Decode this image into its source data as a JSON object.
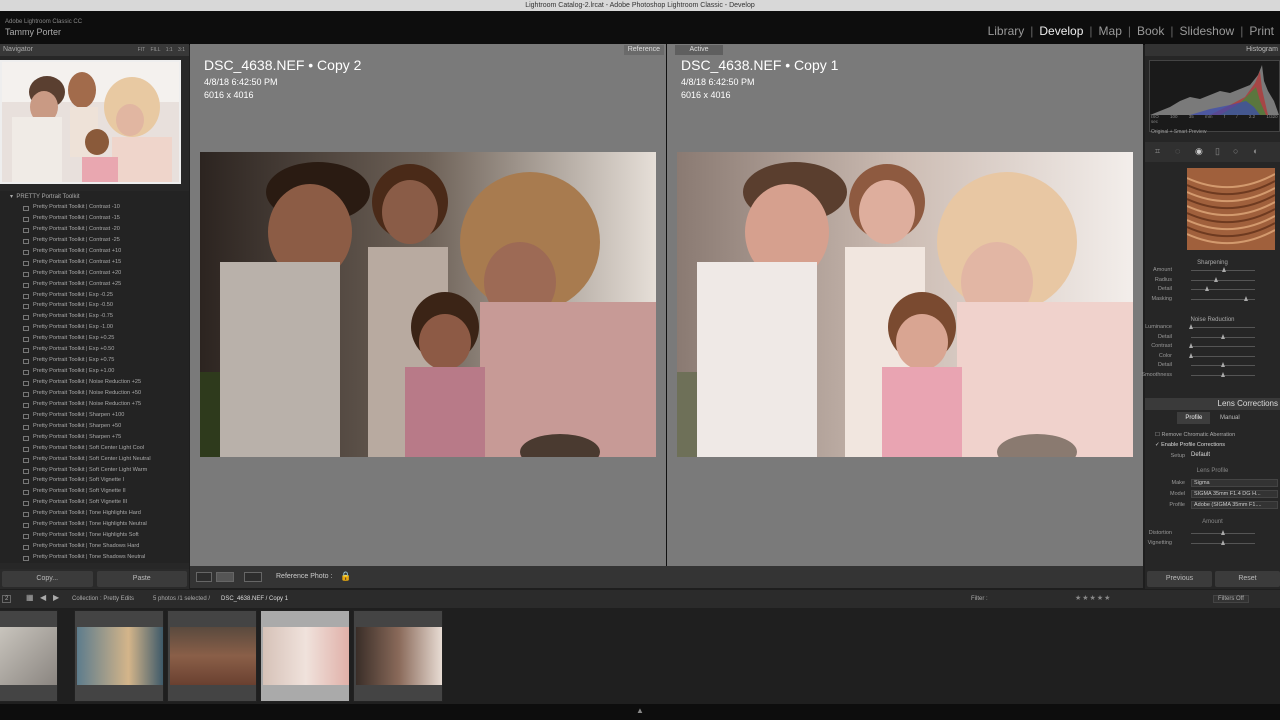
{
  "window": {
    "title": "Lightroom Catalog-2.lrcat - Adobe Photoshop Lightroom Classic - Develop"
  },
  "identity": {
    "app": "Adobe Lightroom Classic CC",
    "user": "Tammy Porter"
  },
  "modules": [
    "Library",
    "Develop",
    "Map",
    "Book",
    "Slideshow",
    "Print"
  ],
  "active_module": "Develop",
  "navigator": {
    "title": "Navigator",
    "zoom": [
      "FIT",
      "FILL",
      "1:1",
      "3:1"
    ]
  },
  "presets": {
    "group": "PRETTY Portrait Toolkit",
    "items": [
      "Pretty Portrait Toolkit | Contrast -10",
      "Pretty Portrait Toolkit | Contrast -15",
      "Pretty Portrait Toolkit | Contrast -20",
      "Pretty Portrait Toolkit | Contrast -25",
      "Pretty Portrait Toolkit | Contrast +10",
      "Pretty Portrait Toolkit | Contrast +15",
      "Pretty Portrait Toolkit | Contrast +20",
      "Pretty Portrait Toolkit | Contrast +25",
      "Pretty Portrait Toolkit | Exp -0.25",
      "Pretty Portrait Toolkit | Exp -0.50",
      "Pretty Portrait Toolkit | Exp -0.75",
      "Pretty Portrait Toolkit | Exp -1.00",
      "Pretty Portrait Toolkit | Exp +0.25",
      "Pretty Portrait Toolkit | Exp +0.50",
      "Pretty Portrait Toolkit | Exp +0.75",
      "Pretty Portrait Toolkit | Exp +1.00",
      "Pretty Portrait Toolkit | Noise Reduction +25",
      "Pretty Portrait Toolkit | Noise Reduction +50",
      "Pretty Portrait Toolkit | Noise Reduction +75",
      "Pretty Portrait Toolkit | Sharpen +100",
      "Pretty Portrait Toolkit | Sharpen +50",
      "Pretty Portrait Toolkit | Sharpen +75",
      "Pretty Portrait Toolkit | Soft Center Light Cool",
      "Pretty Portrait Toolkit | Soft Center Light Neutral",
      "Pretty Portrait Toolkit | Soft Center Light Warm",
      "Pretty Portrait Toolkit | Soft Vignette I",
      "Pretty Portrait Toolkit | Soft Vignette II",
      "Pretty Portrait Toolkit | Soft Vignette III",
      "Pretty Portrait Toolkit | Tone Highlights Hard",
      "Pretty Portrait Toolkit | Tone Highlights Neutral",
      "Pretty Portrait Toolkit | Tone Highlights Soft",
      "Pretty Portrait Toolkit | Tone Shadows Hard",
      "Pretty Portrait Toolkit | Tone Shadows Neutral"
    ]
  },
  "left_buttons": {
    "copy": "Copy...",
    "paste": "Paste"
  },
  "reference": {
    "tag": "Reference",
    "name": "DSC_4638.NEF  •  Copy 2",
    "date": "4/8/18 6:42:50 PM",
    "dims": "6016 x 4016"
  },
  "active": {
    "tag": "Active",
    "name": "DSC_4638.NEF  •  Copy 1",
    "date": "4/8/18 6:42:50 PM",
    "dims": "6016 x 4016"
  },
  "toolbar": {
    "ref_label": "Reference Photo :"
  },
  "histogram": {
    "title": "Histogram",
    "info": [
      "ISO 100",
      "35 mm",
      "f / 2.2",
      "1/320 sec"
    ],
    "preview": "Original + Smart Preview"
  },
  "detail": {
    "sharpening_title": "Sharpening",
    "sharpening": [
      {
        "label": "Amount",
        "value": 0.52
      },
      {
        "label": "Radius",
        "value": 0.4
      },
      {
        "label": "Detail",
        "value": 0.25
      },
      {
        "label": "Masking",
        "value": 0.87
      }
    ],
    "noise_title": "Noise Reduction",
    "noise": [
      {
        "label": "Luminance",
        "value": 0.0
      },
      {
        "label": "Detail",
        "value": 0.5
      },
      {
        "label": "Contrast",
        "value": 0.0
      },
      {
        "label": "Color",
        "value": 0.0
      },
      {
        "label": "Detail",
        "value": 0.5
      },
      {
        "label": "Smoothness",
        "value": 0.5
      }
    ]
  },
  "lens": {
    "title": "Lens Corrections",
    "tabs": [
      "Profile",
      "Manual"
    ],
    "remove_ca": "Remove Chromatic Aberration",
    "enable_profile": "Enable Profile Corrections",
    "setup_label": "Setup",
    "setup_value": "Default",
    "profile_title": "Lens Profile",
    "make_label": "Make",
    "make_value": "Sigma",
    "model_label": "Model",
    "model_value": "SIGMA 35mm F1.4 DG H...",
    "profile_label": "Profile",
    "profile_value": "Adobe (SIGMA 35mm F1....",
    "amount_title": "Amount",
    "distortion_label": "Distortion",
    "distortion_value": 0.5,
    "vignetting_label": "Vignetting",
    "vignetting_value": 0.5
  },
  "right_buttons": {
    "previous": "Previous",
    "reset": "Reset"
  },
  "stripbar": {
    "page": "2",
    "collection": "Collection : Pretty Edits",
    "count": "5 photos /1 selected /",
    "file": "DSC_4638.NEF / Copy 1",
    "filter_label": "Filter :",
    "filter_value": "Filters Off"
  },
  "colors": {
    "accent": "#7a7a7a",
    "panel": "#262626",
    "selected_cell": "#aaaaaa"
  }
}
